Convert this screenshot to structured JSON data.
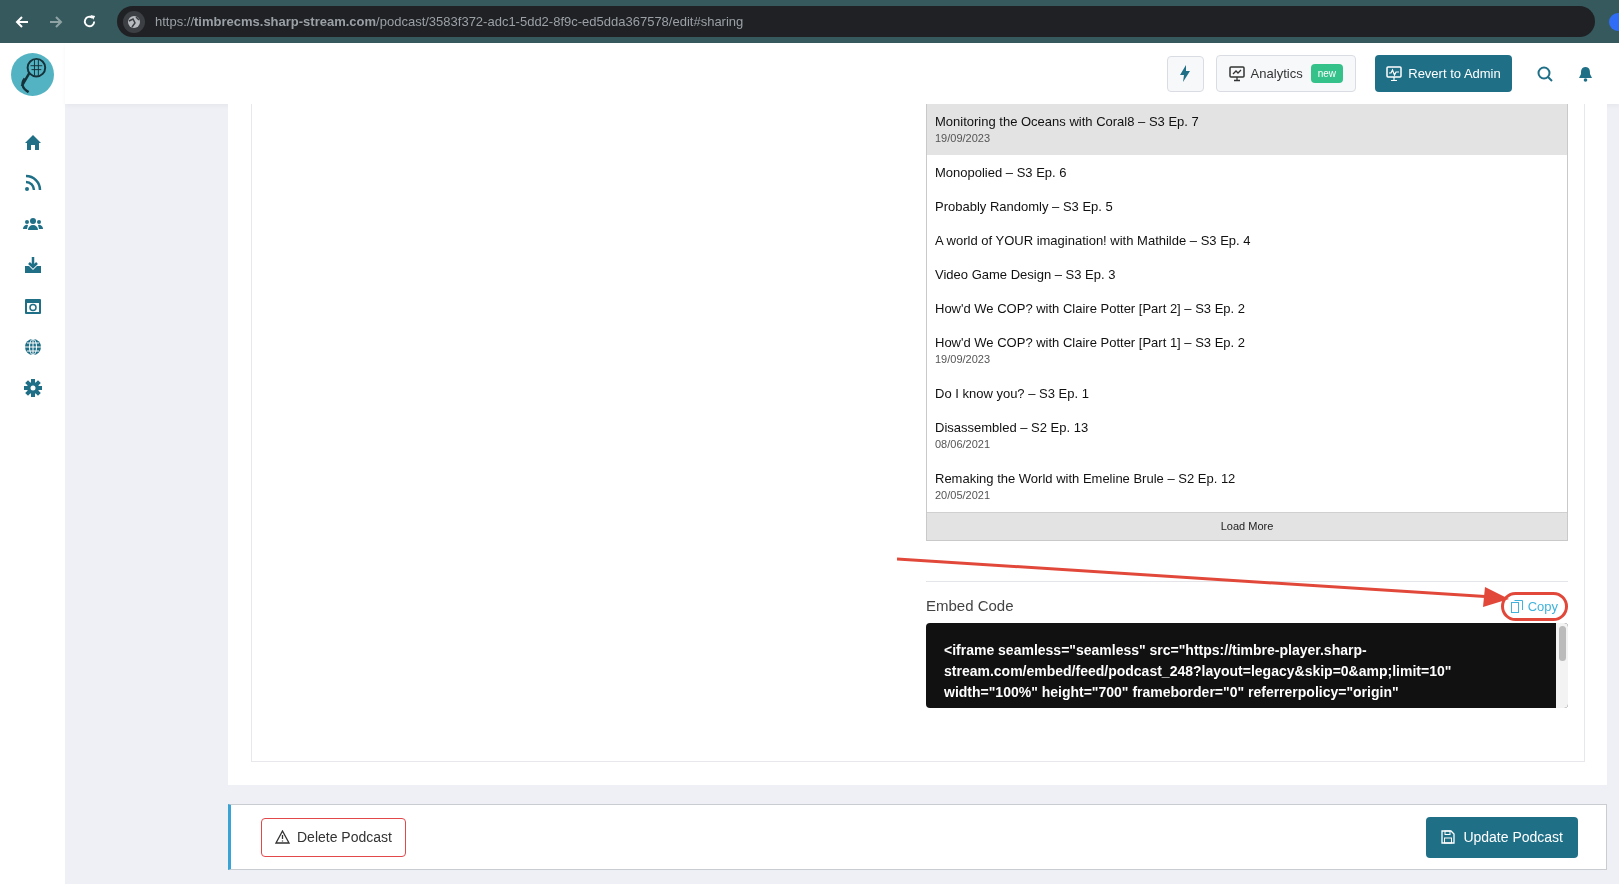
{
  "browser": {
    "url": "https://**timbrecms.sharp-stream.com**/podcast/3583f372-adc1-5dd2-8f9c-ed5dda367578/edit#sharing"
  },
  "sidebar": {
    "items": [
      {
        "kind": "home"
      },
      {
        "kind": "rss"
      },
      {
        "kind": "users"
      },
      {
        "kind": "download"
      },
      {
        "kind": "media"
      },
      {
        "kind": "globe"
      },
      {
        "kind": "settings"
      }
    ]
  },
  "header": {
    "analytics": {
      "label": "Analytics",
      "badge": "new"
    },
    "revert_button": "Revert to Admin"
  },
  "episodes": [
    {
      "title": "Monitoring the Oceans with Coral8 – S3 Ep. 7",
      "date": "19/09/2023",
      "selected": true
    },
    {
      "title": "Monopolied – S3 Ep. 6",
      "selected": false
    },
    {
      "title": "Probably Randomly – S3 Ep. 5",
      "selected": false
    },
    {
      "title": "A world of YOUR imagination! with Mathilde – S3 Ep. 4",
      "selected": false
    },
    {
      "title": "Video Game Design – S3 Ep. 3",
      "selected": false
    },
    {
      "title": "How'd We COP? with Claire Potter [Part 2] – S3 Ep. 2",
      "selected": false
    },
    {
      "title": "How'd We COP? with Claire Potter [Part 1] – S3 Ep. 2",
      "date": "19/09/2023",
      "selected": false
    },
    {
      "title": "Do I know you? – S3 Ep. 1",
      "selected": false
    },
    {
      "title": "Disassembled – S2 Ep. 13",
      "date": "08/06/2021",
      "selected": false
    },
    {
      "title": "Remaking the World with Emeline Brule – S2 Ep. 12",
      "date": "20/05/2021",
      "selected": false
    }
  ],
  "load_more": "Load More",
  "embed": {
    "label": "Embed Code",
    "copy": "Copy",
    "code": "<iframe seamless=\"seamless\" src=\"https://timbre-player.sharp-stream.com/embed/feed/podcast_248?layout=legacy&skip=0&amp;limit=10\" width=\"100%\" height=\"700\" frameborder=\"0\" referrerpolicy=\"origin\""
  },
  "footer": {
    "delete_button": "Delete Podcast",
    "update_button": "Update Podcast"
  }
}
